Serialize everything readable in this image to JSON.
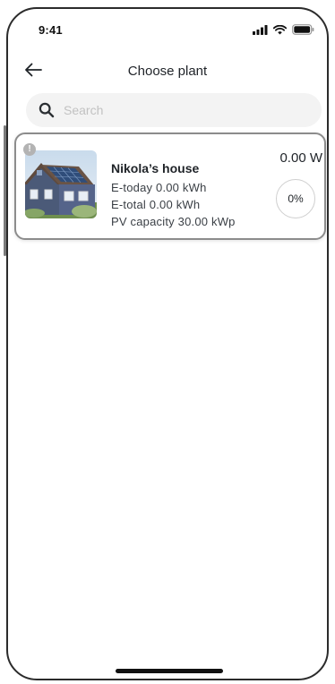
{
  "status_bar": {
    "time": "9:41",
    "icons": [
      "signal-icon",
      "wifi-icon",
      "battery-icon"
    ]
  },
  "header": {
    "back_icon": "arrow-left-icon",
    "title": "Choose plant"
  },
  "search": {
    "placeholder": "Search",
    "value": ""
  },
  "plants": [
    {
      "name": "Nikola’s house",
      "e_today": "E-today 0.00 kWh",
      "e_total": "E-total 0.00 kWh",
      "pv_capacity": "PV capacity 30.00 kWp",
      "power": "0.00 W",
      "percent_label": "0%",
      "percent_value": 0,
      "status_icon": "warning-icon",
      "image_icon": "house-solar-panels-image"
    }
  ],
  "colors": {
    "card_border": "#8c8c8c",
    "search_bg": "#f3f3f3",
    "badge": "#b3b3b3"
  }
}
